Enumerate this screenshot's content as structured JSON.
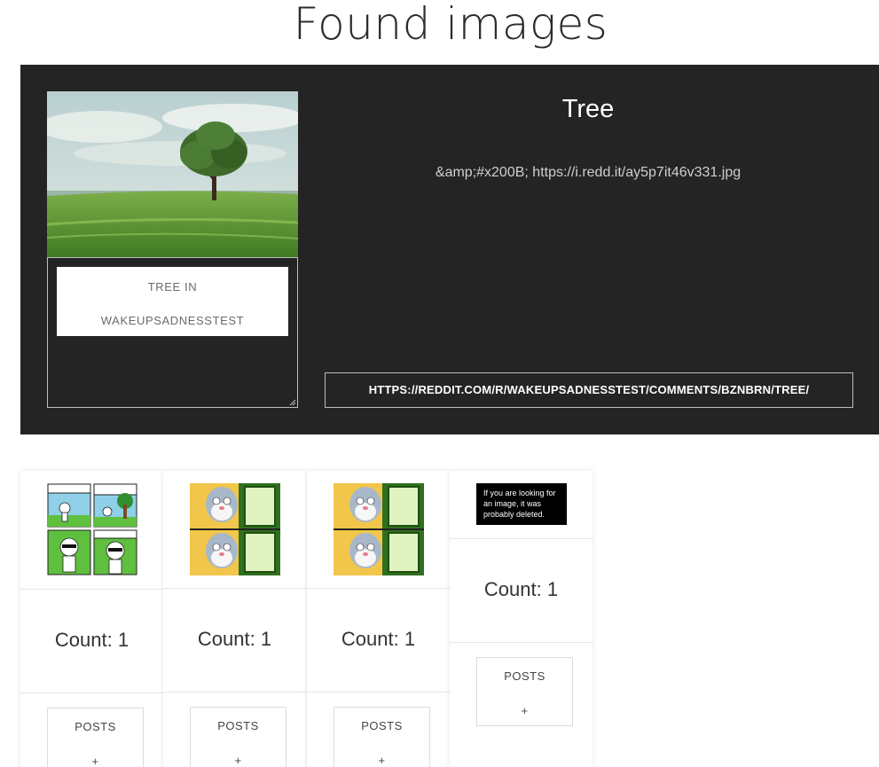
{
  "page": {
    "title": "Found images"
  },
  "featured": {
    "title": "Tree",
    "body": "&amp;#x200B; https://i.redd.it/ay5p7it46v331.jpg",
    "caption_line1": "TREE IN",
    "caption_line2": "WAKEUPSADNESSTEST",
    "link": "HTTPS://REDDIT.COM/R/WAKEUPSADNESSTEST/COMMENTS/BZNBRN/TREE/",
    "image_icon": "tree-on-grass-photo"
  },
  "cards": [
    {
      "count": "Count: 1",
      "posts_label": "POSTS",
      "posts_plus": "+",
      "image_icon": "comic-panels"
    },
    {
      "count": "Count: 1",
      "posts_label": "POSTS",
      "posts_plus": "+",
      "image_icon": "cartoon-rabbit-meme"
    },
    {
      "count": "Count: 1",
      "posts_label": "POSTS",
      "posts_plus": "+",
      "image_icon": "cartoon-rabbit-meme"
    },
    {
      "count": "Count: 1",
      "posts_label": "POSTS",
      "posts_plus": "+",
      "image_icon": "deleted-image-notice",
      "deleted_text": "If you are looking for an image, it was probably deleted."
    }
  ],
  "colors": {
    "featured_bg": "#242424",
    "page_bg": "#ffffff"
  }
}
